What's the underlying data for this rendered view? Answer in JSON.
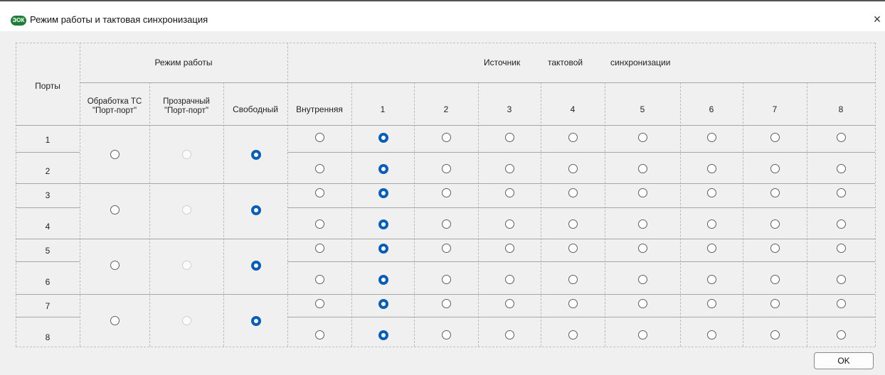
{
  "window": {
    "title": "Режим работы и тактовая синхронизация",
    "app_icon_text": "ЭОК",
    "close_symbol": "×"
  },
  "header": {
    "ports": "Порты",
    "mode_group": "Режим работы",
    "source_words": [
      "Источник",
      "тактовой",
      "синхронизации"
    ],
    "mode_columns": [
      {
        "line1": "Обработка ТС",
        "line2": "\"Порт-порт\""
      },
      {
        "line1": "Прозрачный",
        "line2": "\"Порт-порт\""
      },
      {
        "line1": "Свободный",
        "line2": ""
      }
    ],
    "source_columns": [
      "Внутренняя",
      "1",
      "2",
      "3",
      "4",
      "5",
      "6",
      "7",
      "8"
    ]
  },
  "ports": [
    "1",
    "2",
    "3",
    "4",
    "5",
    "6",
    "7",
    "8"
  ],
  "mode_groups": [
    {
      "ports": "1-2",
      "selected": "Свободный",
      "transparent_enabled": false
    },
    {
      "ports": "3-4",
      "selected": "Свободный",
      "transparent_enabled": false
    },
    {
      "ports": "5-6",
      "selected": "Свободный",
      "transparent_enabled": false
    },
    {
      "ports": "7-8",
      "selected": "Свободный",
      "transparent_enabled": false
    }
  ],
  "sync_source_selected": [
    "1",
    "1",
    "1",
    "1",
    "1",
    "1",
    "1",
    "1"
  ],
  "buttons": {
    "ok": "OK"
  }
}
